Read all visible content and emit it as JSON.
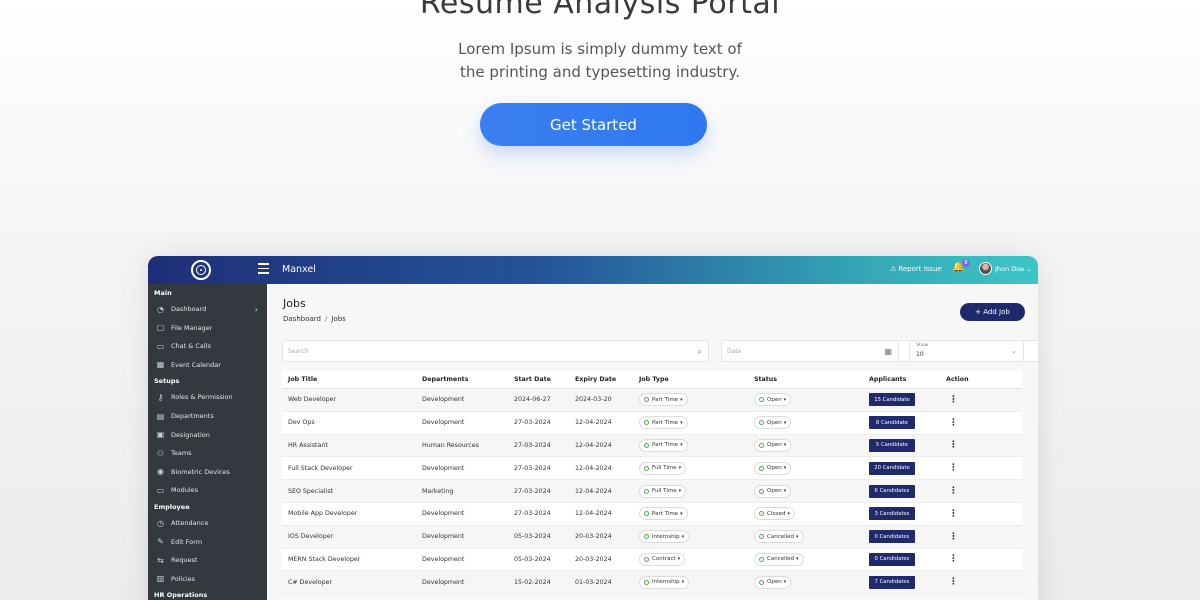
{
  "hero": {
    "title": "Resume Analysis Portal",
    "subtitle_line1": "Lorem Ipsum is simply dummy text of",
    "subtitle_line2": "the printing and typesetting industry.",
    "cta_label": "Get Started"
  },
  "topbar": {
    "brand": "Manxel",
    "report_label": "Report Issue",
    "notification_count": "8",
    "user_name": "Jhon Doe"
  },
  "sidebar": {
    "sections": [
      {
        "label": "Main",
        "items": [
          {
            "label": "Dashboard",
            "icon": "dashboard-icon",
            "has_chevron": true
          },
          {
            "label": "File Manager",
            "icon": "file-icon"
          },
          {
            "label": "Chat & Calls",
            "icon": "chat-icon"
          },
          {
            "label": "Event Calendar",
            "icon": "calendar-icon"
          }
        ]
      },
      {
        "label": "Setups",
        "items": [
          {
            "label": "Roles & Permission",
            "icon": "key-icon"
          },
          {
            "label": "Departments",
            "icon": "departments-icon"
          },
          {
            "label": "Designation",
            "icon": "designation-icon"
          },
          {
            "label": "Teams",
            "icon": "teams-icon"
          },
          {
            "label": "Biometric Devices",
            "icon": "biometric-icon"
          },
          {
            "label": "Modules",
            "icon": "monitor-icon"
          }
        ]
      },
      {
        "label": "Employee",
        "items": [
          {
            "label": "Attendance",
            "icon": "clock-icon"
          },
          {
            "label": "Edit Form",
            "icon": "edit-icon"
          },
          {
            "label": "Request",
            "icon": "request-icon"
          },
          {
            "label": "Policies",
            "icon": "policy-icon"
          }
        ]
      },
      {
        "label": "HR Operations",
        "items": []
      }
    ]
  },
  "main": {
    "title": "Jobs",
    "breadcrumb": [
      "Dashboard",
      "Jobs"
    ],
    "add_button": "+ Add Job",
    "search_placeholder": "Search",
    "date_placeholder": "Date",
    "show_label": "Show",
    "show_value": "10"
  },
  "table": {
    "headers": [
      "Job Title",
      "Departments",
      "Start Date",
      "Expiry Date",
      "Job Type",
      "Status",
      "Applicants",
      "Action"
    ],
    "rows": [
      {
        "title": "Web Developer",
        "dept": "Development",
        "start": "2024-06-27",
        "expiry": "2024-03-20",
        "type": "Part Time",
        "status": "Open",
        "applicants": "15 Candidate"
      },
      {
        "title": "Dev Ops",
        "dept": "Development",
        "start": "27-03-2024",
        "expiry": "12-04-2024",
        "type": "Part Time",
        "status": "Open",
        "applicants": "8 Candidate"
      },
      {
        "title": "HR Assistant",
        "dept": "Human Resources",
        "start": "27-03-2024",
        "expiry": "12-04-2024",
        "type": "Part Time",
        "status": "Open",
        "applicants": "5 Candidate"
      },
      {
        "title": "Full Stack Developer",
        "dept": "Development",
        "start": "27-03-2024",
        "expiry": "12-04-2024",
        "type": "Full Time",
        "status": "Open",
        "applicants": "20 Candidate"
      },
      {
        "title": "SEO Specialist",
        "dept": "Marketing",
        "start": "27-03-2024",
        "expiry": "12-04-2024",
        "type": "Full Time",
        "status": "Open",
        "applicants": "6 Candidates"
      },
      {
        "title": "Mobile App Developer",
        "dept": "Development",
        "start": "27-03-2024",
        "expiry": "12-04-2024",
        "type": "Part Time",
        "status": "Closed",
        "applicants": "3 Candidates"
      },
      {
        "title": "IOS Developer",
        "dept": "Development",
        "start": "05-03-2024",
        "expiry": "20-03-2024",
        "type": "Internship",
        "status": "Cancelled",
        "applicants": "0 Candidates"
      },
      {
        "title": "MERN Stack Developer",
        "dept": "Development",
        "start": "05-03-2024",
        "expiry": "20-03-2024",
        "type": "Contract",
        "status": "Cancelled",
        "applicants": "0 Candidates"
      },
      {
        "title": "C# Developer",
        "dept": "Development",
        "start": "15-02-2024",
        "expiry": "01-03-2024",
        "type": "Internship",
        "status": "Open",
        "applicants": "7 Candidates"
      }
    ]
  },
  "colors": {
    "primary": "#1f2a6d",
    "cta": "#2f78f0",
    "sidebar": "#34393f",
    "status_dot": "#4caf50"
  }
}
